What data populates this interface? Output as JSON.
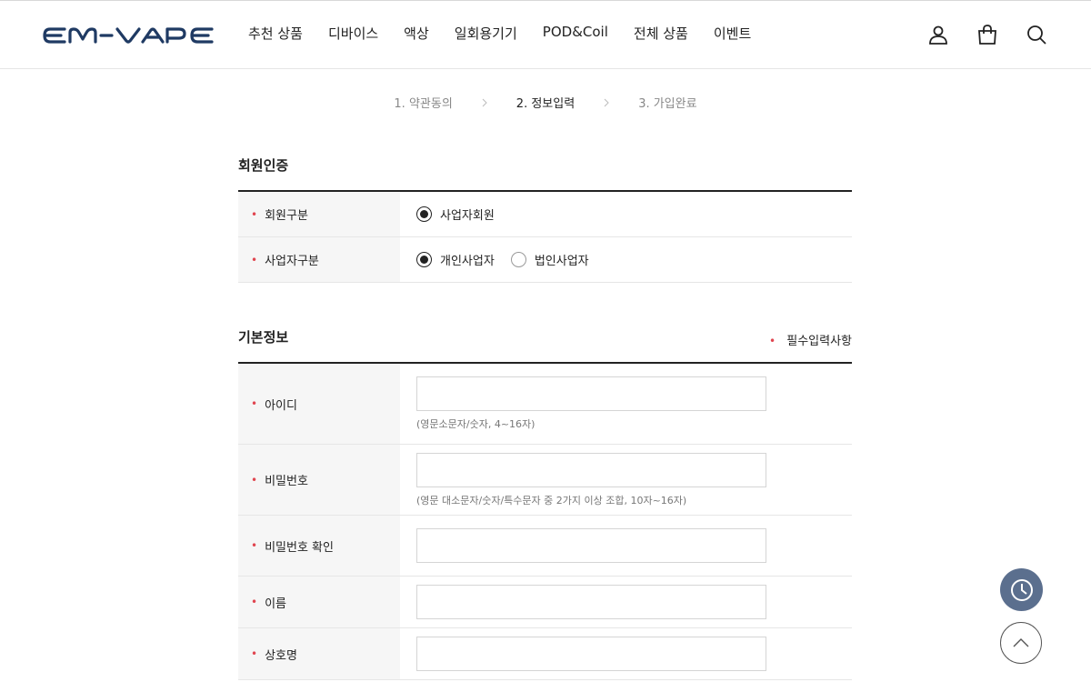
{
  "header": {
    "logo_text": "EM-VAPE",
    "nav": [
      "추천 상품",
      "디바이스",
      "액상",
      "일회용기기",
      "POD&Coil",
      "전체 상품",
      "이벤트"
    ],
    "icons": [
      "user-icon",
      "cart-icon",
      "search-icon"
    ]
  },
  "steps": {
    "step1": "1. 약관동의",
    "step2": "2. 정보입력",
    "step3": "3. 가입완료"
  },
  "auth_section": {
    "title": "회원인증",
    "rows": {
      "member_type": {
        "label": "회원구분",
        "option": "사업자회원"
      },
      "business_type": {
        "label": "사업자구분",
        "option1": "개인사업자",
        "option2": "법인사업자"
      }
    }
  },
  "basic_section": {
    "title": "기본정보",
    "required_note": "필수입력사항",
    "fields": {
      "userid": {
        "label": "아이디",
        "value": "",
        "hint": "(영문소문자/숫자, 4~16자)"
      },
      "password": {
        "label": "비밀번호",
        "value": "",
        "hint": "(영문 대소문자/숫자/특수문자 중 2가지 이상 조합, 10자~16자)"
      },
      "password_confirm": {
        "label": "비밀번호 확인",
        "value": ""
      },
      "name": {
        "label": "이름",
        "value": ""
      },
      "company": {
        "label": "상호명",
        "value": ""
      }
    }
  },
  "colors": {
    "accent_dot": "#e0454f",
    "logo": "#1f3a63",
    "recent_button": "#5b6f8e"
  }
}
